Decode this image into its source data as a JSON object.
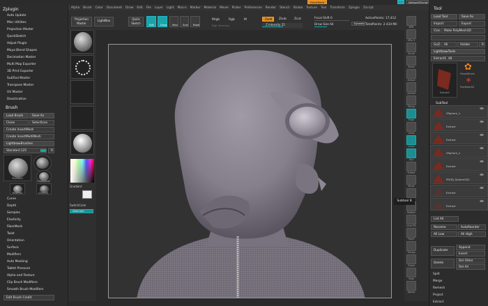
{
  "menu": [
    "Alpha",
    "Brush",
    "Color",
    "Document",
    "Draw",
    "Edit",
    "File",
    "Layer",
    "Light",
    "Macro",
    "Marker",
    "Material",
    "Movie",
    "Picker",
    "Preferences",
    "Render",
    "Stencil",
    "Stroke",
    "Texture",
    "Tool",
    "Transform",
    "Zplugin",
    "Zscript"
  ],
  "top_right": {
    "quicksave": "QuickSave",
    "script": "DefaultZScript"
  },
  "zplugin": {
    "title": "Zplugin",
    "items": [
      "Auto Update",
      "Misc Utilities",
      "Projection Master",
      "QuickSketch",
      "Adjust Plugin",
      "Maya Blend Shapes",
      "Decimation Master",
      "Multi Map Exporter",
      "3D Print Exporter",
      "SubTool Master",
      "Transpose Master",
      "UV Master",
      "Deactivation"
    ]
  },
  "brush": {
    "title": "Brush",
    "load": "Load Brush",
    "save_as": "Save As",
    "clone": "Clone",
    "select_icon": "SelectIcon",
    "create_insert": "Create InsertMesh",
    "create_insert_multi": "Create InsertMultiMesh",
    "lightbox": "Lightbox▸Brushes",
    "standard": "Standard.125",
    "r": "R",
    "thumbs": [
      "Standard",
      "Clay",
      "ClayBuildup",
      "MoveTool",
      "Chisel3D"
    ],
    "sections": [
      "Curve",
      "Depth",
      "Samples",
      "Elasticity",
      "FiberMesh",
      "Twist",
      "Orientation",
      "Surface",
      "Modifiers",
      "Auto Masking",
      "Tablet Pressure",
      "Alpha and Texture",
      "Clip Brush Modifiers",
      "Smooth Brush Modifiers"
    ],
    "edit": "Edit Brush Credit"
  },
  "shelf": {
    "projection": "Projection Master",
    "lightbox": "LightBox",
    "quick_sketch": "Quick Sketch",
    "edit": "Edit",
    "draw": "Draw",
    "move": "Move",
    "scale": "Scale",
    "rotate": "Rotate",
    "mrgb": "Mrgb",
    "rgb": "Rgb",
    "m": "M",
    "rgb_intensity": "Rgb Intensity",
    "zadd": "Zadd",
    "zsub": "Zsub",
    "zcut": "Zcut",
    "z_intensity": "Z Intensity 25",
    "focal": "Focal Shift 0",
    "draw_size": "Draw Size 64",
    "dynamic": "Dynamic",
    "active_points": "ActivePoints: 17,412",
    "total_points": "TotalPoints: 2.434 Mil"
  },
  "left_shelf": {
    "gradient": "Gradient",
    "switch_color": "SwitchColor",
    "alternate": "Alternate"
  },
  "right_shelf": [
    "BPR",
    "SPix 3",
    "Scroll",
    "Zoom",
    "Actual",
    "AAHalf",
    "Persp",
    "Floor",
    "Local",
    "LSym",
    "Xyz",
    "Frame",
    "Move",
    "Scale",
    "Rotate",
    "Line Fill",
    "PolyF",
    "Transp",
    "Ghost",
    "Solo",
    "Xpose"
  ],
  "tooltip": "Subtool 8",
  "tool": {
    "title": "Tool",
    "load": "Load Tool",
    "save_as": "Save As",
    "import": "Import",
    "export": "Export",
    "clone": "Clone",
    "make_polymesh": "Make PolyMesh3D",
    "goz": "GoZ",
    "all": "All",
    "visible": "Visible",
    "r": "R",
    "lightbox": "Lightbox▸Tools",
    "extract_name": "Extract1. 48",
    "thumbs": [
      "Extract1",
      "SimpleBrush",
      "PolyMesh3D",
      "Extract1"
    ],
    "subtool_title": "SubTool",
    "subtools": [
      "ZSphere_1",
      "Extract",
      "Extract",
      "ZSphere_2",
      "Extract",
      "PM3D_Sphere3D1",
      "Extract",
      "Extract"
    ],
    "list_all": "List All",
    "rename": "Rename",
    "auto_reorder": "AutoReorder",
    "all_low": "All Low",
    "all_high": "All High",
    "duplicate": "Duplicate",
    "append": "Append",
    "insert": "Insert",
    "delete": "Delete",
    "del_other": "Del Other",
    "del_all": "Del All",
    "split": "Split",
    "merge": "Merge",
    "remesh": "Remesh",
    "project": "Project",
    "extract": "Extract"
  }
}
